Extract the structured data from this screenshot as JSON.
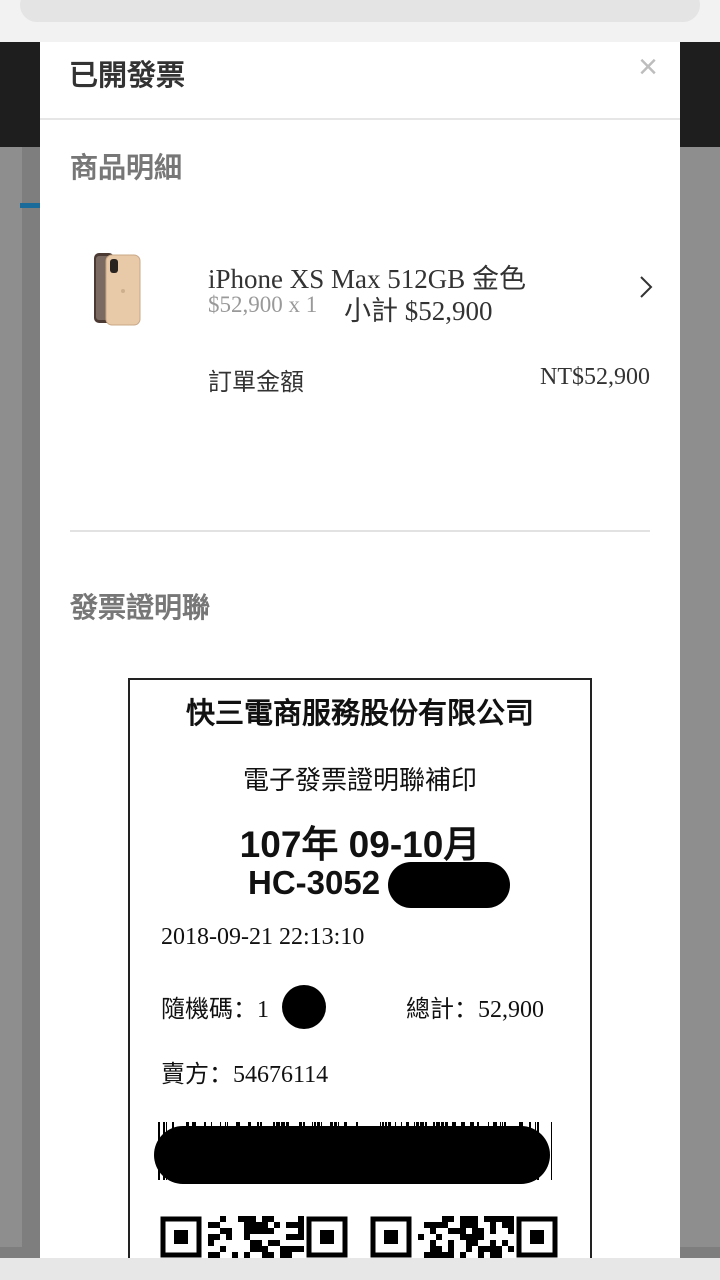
{
  "modal": {
    "title": "已開發票",
    "close_symbol": "×"
  },
  "product_section": {
    "title": "商品明細",
    "item": {
      "name": "iPhone XS Max 512GB 金色",
      "price_qty": "$52,900 x 1",
      "subtotal": "小計 $52,900"
    },
    "order_total_label": "訂單金額",
    "order_total_value": "NT$52,900"
  },
  "invoice_section": {
    "title": "發票證明聯"
  },
  "receipt": {
    "company": "快三電商服務股份有限公司",
    "subtitle": "電子發票證明聯補印",
    "period": "107年 09-10月",
    "number_visible": "HC-3052",
    "datetime": "2018-09-21 22:13:10",
    "random_label": "隨機碼：",
    "random_visible": "1",
    "total_label": "總計：",
    "total_value": "52,900",
    "seller_label": "賣方：",
    "seller_value": "54676114"
  },
  "colors": {
    "accent": "#1a6a9a",
    "product_gold": "#e8c9a8"
  },
  "icons": {
    "close": "close-icon",
    "chevron": "chevron-right-icon"
  }
}
